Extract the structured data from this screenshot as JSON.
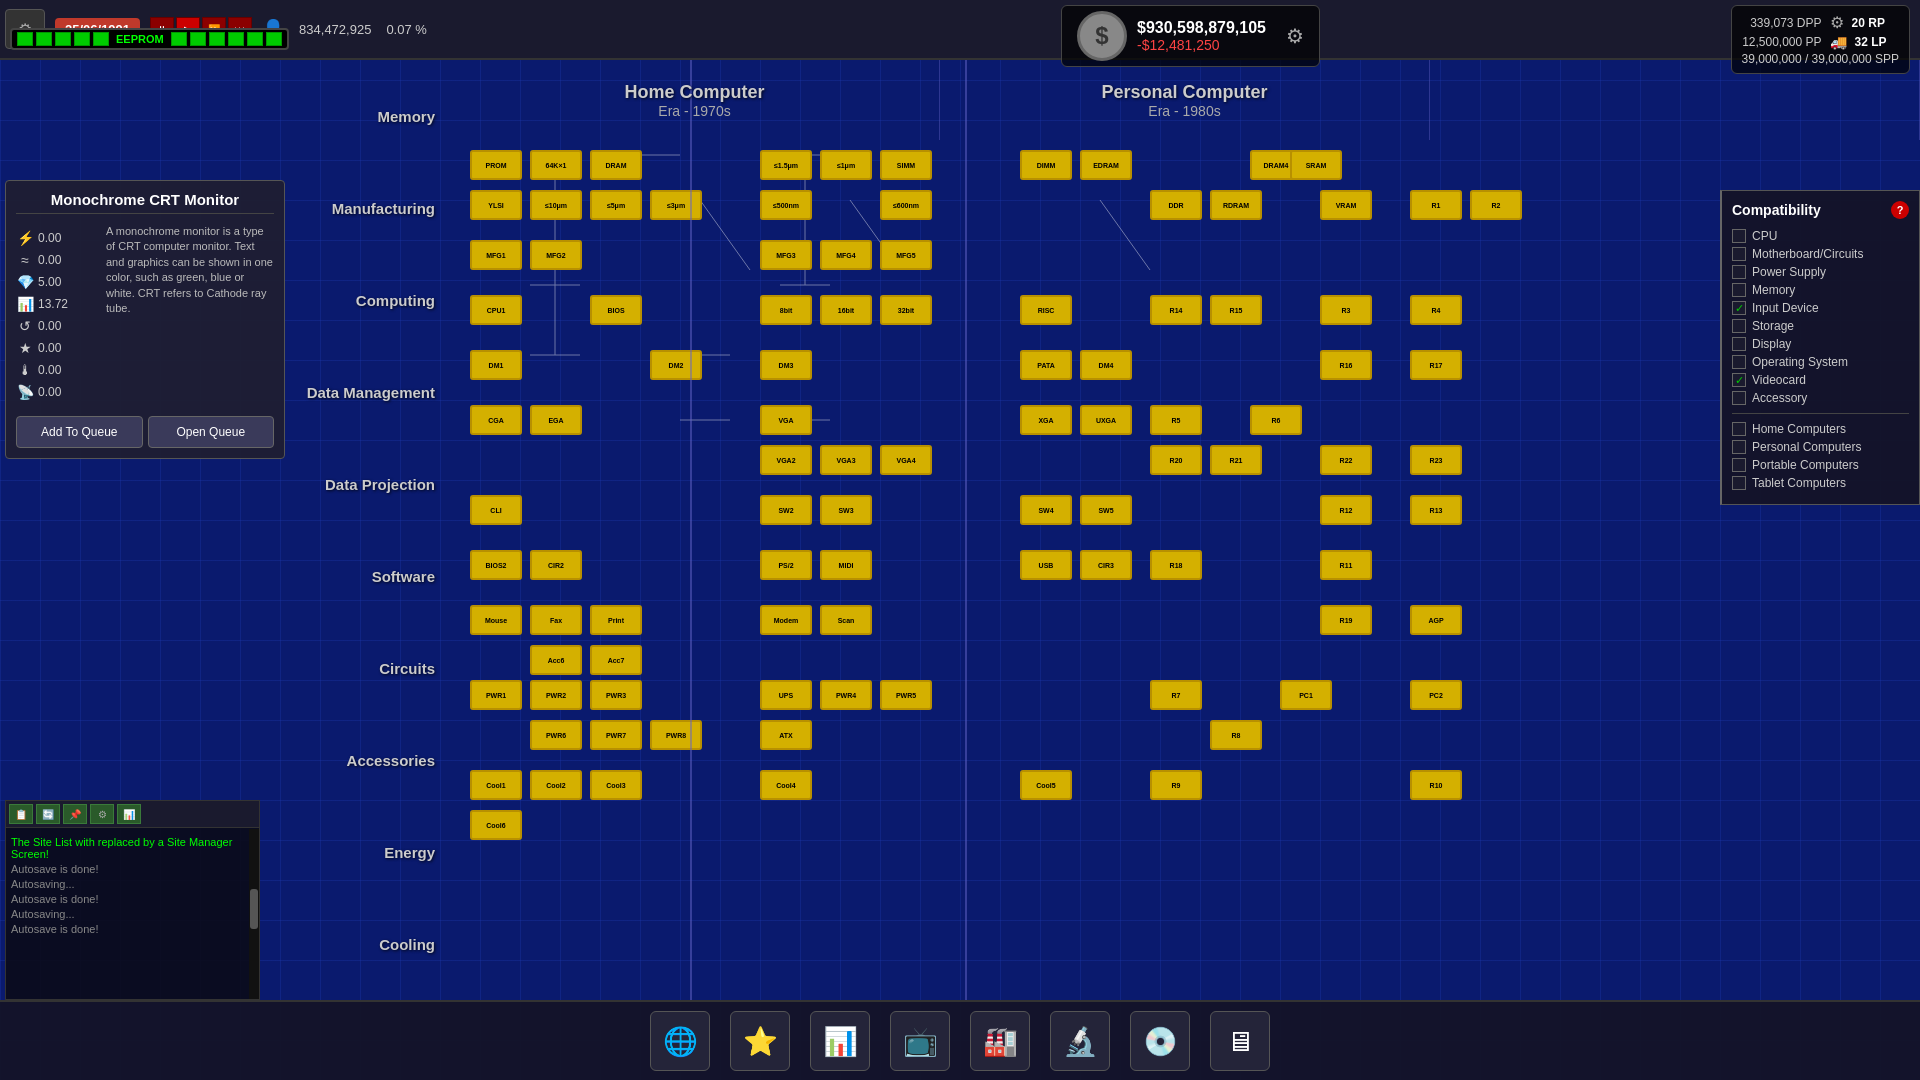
{
  "topbar": {
    "date": "25/06/1991",
    "population": "834,472,925",
    "percent": "0.07 %",
    "eeprom_label": "EEPROM",
    "settings_icon": "⚙"
  },
  "money": {
    "dollar_sign": "$",
    "total": "$930,598,879,105",
    "change": "-$12,481,250"
  },
  "stats": {
    "dpp_value": "339,073 DPP",
    "pp_value": "12,500,000 PP",
    "rp_value": "20 RP",
    "lp_value": "32 LP",
    "spp_value": "39,000,000 / 39,000,000 SPP",
    "truck_icon": "🚚",
    "factory_icon": "🏭"
  },
  "era_headers": [
    {
      "title": "Home Computer",
      "subtitle": "Era - 1970s"
    },
    {
      "title": "Personal Computer",
      "subtitle": "Era - 1980s"
    },
    {
      "title": "",
      "subtitle": ""
    }
  ],
  "row_labels": [
    "Memory",
    "Manufacturing",
    "Computing",
    "Data Management",
    "Data Projection",
    "Software",
    "Circuits",
    "Accessories",
    "Energy",
    "Cooling"
  ],
  "item_panel": {
    "title": "Monochrome CRT Monitor",
    "stats": [
      {
        "icon": "⚡",
        "value": "0.00"
      },
      {
        "icon": "≈",
        "value": "0.00"
      },
      {
        "icon": "💎",
        "value": "5.00"
      },
      {
        "icon": "📊",
        "value": "13.72"
      },
      {
        "icon": "↺",
        "value": "0.00"
      },
      {
        "icon": "★",
        "value": "0.00"
      },
      {
        "icon": "🌡",
        "value": "0.00"
      },
      {
        "icon": "📡",
        "value": "0.00"
      }
    ],
    "description": "A monochrome monitor is a type of CRT computer monitor. Text and graphics can be shown in one color, such as green, blue or white. CRT refers to Cathode ray tube.",
    "add_btn": "Add To Queue",
    "open_btn": "Open Queue"
  },
  "compatibility": {
    "title": "Compatibility",
    "help_icon": "?",
    "categories": [
      {
        "label": "CPU",
        "checked": false
      },
      {
        "label": "Motherboard/Circuits",
        "checked": false
      },
      {
        "label": "Power Supply",
        "checked": false
      },
      {
        "label": "Memory",
        "checked": false
      },
      {
        "label": "Input Device",
        "checked": true
      },
      {
        "label": "Storage",
        "checked": false
      },
      {
        "label": "Display",
        "checked": false
      },
      {
        "label": "Operating System",
        "checked": false
      },
      {
        "label": "Videocard",
        "checked": true
      },
      {
        "label": "Accessory",
        "checked": false
      }
    ],
    "computer_types": [
      {
        "label": "Home Computers",
        "checked": false
      },
      {
        "label": "Personal Computers",
        "checked": false
      },
      {
        "label": "Portable Computers",
        "checked": false
      },
      {
        "label": "Tablet Computers",
        "checked": false
      }
    ]
  },
  "log": {
    "messages": [
      {
        "text": "The Site List with replaced by a Site Manager Screen!",
        "type": "highlight"
      },
      {
        "text": "Autosave is done!",
        "type": "normal"
      },
      {
        "text": "",
        "type": "normal"
      },
      {
        "text": "Autosaving...",
        "type": "normal"
      },
      {
        "text": "",
        "type": "normal"
      },
      {
        "text": "Autosave is done!",
        "type": "normal"
      },
      {
        "text": "",
        "type": "normal"
      },
      {
        "text": "Autosaving...",
        "type": "normal"
      },
      {
        "text": "",
        "type": "normal"
      },
      {
        "text": "Autosave is done!",
        "type": "normal"
      }
    ]
  },
  "bottom_buttons": [
    {
      "icon": "🌐",
      "name": "world"
    },
    {
      "icon": "⭐",
      "name": "favorites"
    },
    {
      "icon": "📊",
      "name": "charts"
    },
    {
      "icon": "📺",
      "name": "media"
    },
    {
      "icon": "🏭",
      "name": "factory"
    },
    {
      "icon": "🔬",
      "name": "research"
    },
    {
      "icon": "💿",
      "name": "disc"
    },
    {
      "icon": "🖥",
      "name": "computer"
    }
  ]
}
